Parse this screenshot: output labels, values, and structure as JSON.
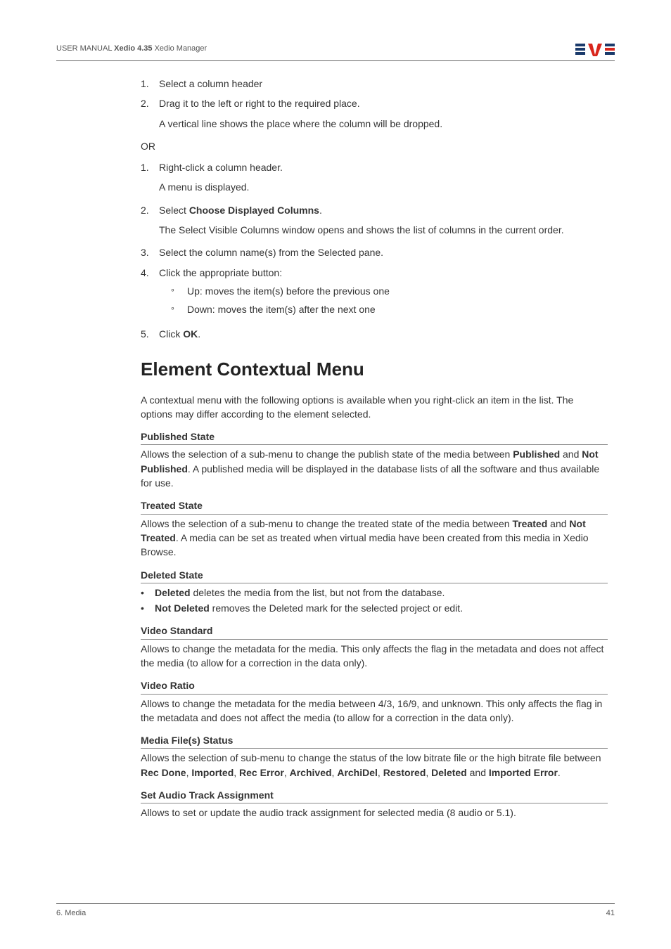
{
  "header": {
    "manual_prefix": "USER MANUAL ",
    "manual_bold": "Xedio 4.35",
    "manual_suffix": " Xedio Manager"
  },
  "list1": [
    {
      "num": "1.",
      "text": "Select a column header"
    },
    {
      "num": "2.",
      "text": "Drag it to the left or right to the required place."
    }
  ],
  "list1_follow": "A vertical line shows the place where the column will be dropped.",
  "or_label": "OR",
  "list2_1_num": "1.",
  "list2_1_text": "Right-click a column header.",
  "list2_1_follow": "A menu is displayed.",
  "list2_2_num": "2.",
  "list2_2_prefix": "Select ",
  "list2_2_bold": "Choose Displayed Columns",
  "list2_2_suffix": ".",
  "list2_2_follow": "The Select Visible Columns window opens and shows the list of columns in the current order.",
  "list2_3_num": "3.",
  "list2_3_text": "Select the column name(s) from the Selected pane.",
  "list2_4_num": "4.",
  "list2_4_text": "Click the appropriate button:",
  "list2_4_sub": [
    "Up: moves the item(s) before the previous one",
    "Down: moves the item(s) after the next one"
  ],
  "list2_5_num": "5.",
  "list2_5_prefix": "Click ",
  "list2_5_bold": "OK",
  "list2_5_suffix": ".",
  "section_title": "Element Contextual Menu",
  "intro": "A contextual menu with the following options is available when you right-click an item in the list. The options may differ according to the element selected.",
  "published": {
    "heading": "Published State",
    "p1": "Allows the selection of a sub-menu to change the publish state of the media between ",
    "b1": "Published",
    "p2": " and ",
    "b2": "Not Published",
    "p3": ". A published media will be displayed in the database lists of all the software and thus available for use."
  },
  "treated": {
    "heading": "Treated State",
    "p1": "Allows the selection of a sub-menu to change the treated state of the media between ",
    "b1": "Treated",
    "p2": " and ",
    "b2": "Not Treated",
    "p3": ". A media can be set as treated when virtual media have been created from this media in Xedio Browse."
  },
  "deleted": {
    "heading": "Deleted State",
    "li1_b": "Deleted",
    "li1_t": " deletes the media from the list, but not from the database.",
    "li2_b": "Not Deleted",
    "li2_t": " removes the Deleted mark for the selected project or edit."
  },
  "vstd": {
    "heading": "Video Standard",
    "text": "Allows to change the metadata for the media. This only affects the flag in the metadata and does not affect the media (to allow for a correction in the data only)."
  },
  "vratio": {
    "heading": "Video Ratio",
    "text": "Allows to change the metadata for the media between 4/3, 16/9, and unknown. This only affects the flag in the metadata and does not affect the media (to allow for a correction in the data only)."
  },
  "mfs": {
    "heading": "Media File(s) Status",
    "p1": "Allows the selection of sub-menu to change the status of the low bitrate file or the high bitrate file between ",
    "b1": "Rec Done",
    "c1": ", ",
    "b2": "Imported",
    "c2": ", ",
    "b3": "Rec Error",
    "c3": ", ",
    "b4": "Archived",
    "c4": ", ",
    "b5": "ArchiDel",
    "c5": ", ",
    "b6": "Restored",
    "c6": ", ",
    "b7": "Deleted",
    "c7": " and ",
    "b8": "Imported Error",
    "c8": "."
  },
  "audio": {
    "heading": "Set Audio Track Assignment",
    "text": "Allows to set or update the audio track assignment for selected media (8 audio or 5.1)."
  },
  "footer": {
    "left": "6. Media",
    "right": "41"
  }
}
